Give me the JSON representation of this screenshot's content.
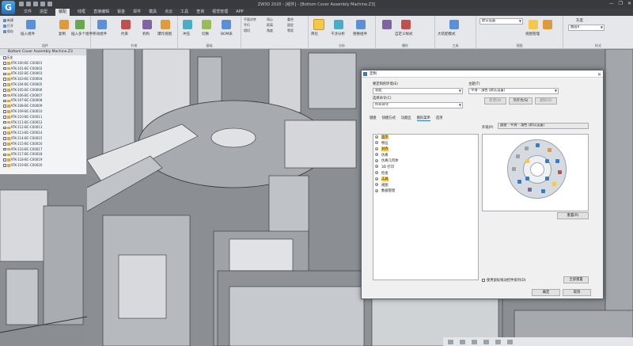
{
  "window": {
    "title": "ZW3D 2020 - [组件] - [Bottom Cover Assembly Machine.Z3]",
    "controls": [
      "—",
      "❐",
      "✕"
    ]
  },
  "ribbon": {
    "tabs": [
      "文件",
      "造型",
      "装配",
      "线框",
      "直接编辑",
      "钣金",
      "焊件",
      "模具",
      "点云",
      "工具",
      "查询",
      "视觉管理",
      "APP"
    ],
    "active_tab": "装配",
    "buttons": {
      "insert_component": "插入组件",
      "insert_multi": "插入多个组件",
      "copy": "复制",
      "move": "移动组件",
      "constraint": "约束",
      "mechanism": "机构",
      "exploded": "爆炸视图",
      "sheet_metal": "冲压",
      "switch": "切换",
      "bom": "BOM表",
      "simplify": "简化",
      "analysis": "干涉分析",
      "replace": "替换组件",
      "custom_style": "自定义样式",
      "large_asm": "大装配模式",
      "view": "视图管理"
    },
    "groups": [
      "组件",
      "约束",
      "基础",
      "分析",
      "爆炸",
      "工具",
      "视图",
      "样式"
    ],
    "mini_items": [
      "平面对齐",
      "平行",
      "相切",
      "同心",
      "距离",
      "角度",
      "重合",
      "固定",
      "等距"
    ],
    "style_combo": "默认设置",
    "tone_label": "灰度",
    "layer_combo": "图层0"
  },
  "tree": {
    "header": "Bottom Cover Assembly Machine.Z3",
    "rows": [
      "历史",
      "ATK-100-BC-C00001",
      "ATK-101-BC-C00002",
      "ATK-102-BC-C00003",
      "ATK-103-BC-C00004",
      "ATK-104-BC-C00005",
      "ATK-105-BC-C00006",
      "ATK-106-BC-C00007",
      "ATK-107-BC-C00008",
      "ATK-108-BC-C00009",
      "ATK-109-BC-C00010",
      "ATK-110-BC-C00011",
      "ATK-111-BC-C00012",
      "ATK-112-BC-C00013",
      "ATK-113-BC-C00014",
      "ATK-114-BC-C00015",
      "ATK-115-BC-C00016",
      "ATK-116-BC-C00017",
      "ATK-117-BC-C00018",
      "ATK-118-BC-C00019",
      "ATK-119-BC-C00020"
    ]
  },
  "dialog": {
    "title": "定制",
    "close": "✕",
    "env_label": "要定制的环境(E)",
    "env_value": "装配",
    "cmd_label": "选择命令(C)",
    "cmd_value": "所有命令",
    "cmd2_value": "所有命令",
    "theme_label": "主题(T)",
    "theme_value": "平滑 - 浅色 (默认设置)",
    "theme_buttons": [
      "新建(N)",
      "另存为(S)",
      "删除(D)"
    ],
    "tabs": [
      "键盘",
      "快捷方式",
      "功能区",
      "图形菜单",
      "选项"
    ],
    "active_tab": "图形菜单",
    "preview_label": "外观(P)",
    "preview_value": "圆盘 - 平滑 - 浅色 (默认设置)",
    "list": [
      {
        "label": "显示",
        "hl": true
      },
      {
        "label": "特征",
        "hl": false
      },
      {
        "label": "对齐",
        "hl": true
      },
      {
        "label": "仿真",
        "hl": false
      },
      {
        "label": "仿真几何体",
        "hl": false
      },
      {
        "label": "3D 打印",
        "hl": false
      },
      {
        "label": "检查",
        "hl": false
      },
      {
        "label": "工具",
        "hl": true
      },
      {
        "label": "视图",
        "hl": false
      },
      {
        "label": "数据管理",
        "hl": false
      }
    ],
    "reset_btn": "重置(R)",
    "checkbox_label": "使用鼠标拖动控件排列(D)",
    "reset_all": "全部重置",
    "ok": "确定",
    "cancel": "取消"
  },
  "colors": {
    "accent": "#2f7dd1",
    "highlight": "#f5c84a",
    "titlebar": "#383a3e",
    "ribbon": "#e6e7ea"
  }
}
